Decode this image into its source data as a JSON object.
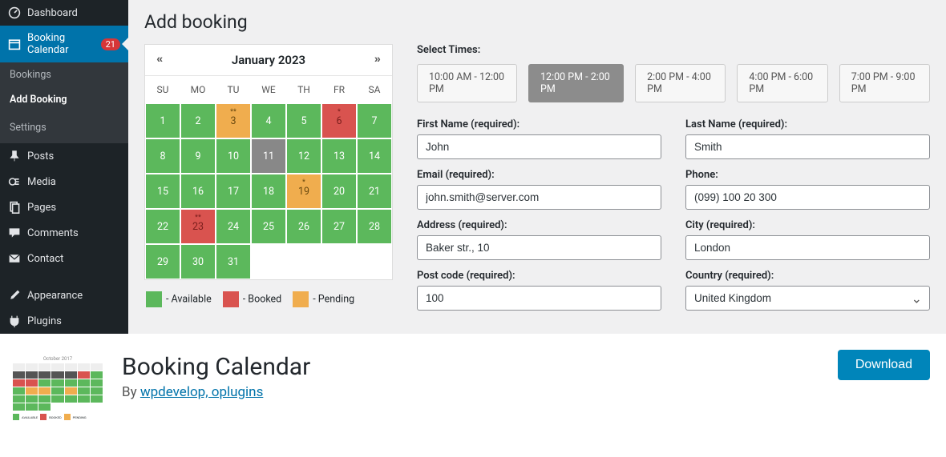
{
  "sidebar": {
    "dashboard": "Dashboard",
    "booking_calendar": "Booking Calendar",
    "badge": "21",
    "bookings": "Bookings",
    "add_booking": "Add Booking",
    "settings": "Settings",
    "posts": "Posts",
    "media": "Media",
    "pages": "Pages",
    "comments": "Comments",
    "contact": "Contact",
    "appearance": "Appearance",
    "plugins": "Plugins"
  },
  "page": {
    "title": "Add booking"
  },
  "calendar": {
    "month_label": "January 2023",
    "day_headers": [
      "SU",
      "MO",
      "TU",
      "WE",
      "TH",
      "FR",
      "SA"
    ],
    "cells": [
      {
        "day": "1",
        "status": "available"
      },
      {
        "day": "2",
        "status": "available"
      },
      {
        "day": "3",
        "status": "pending",
        "mark": "**"
      },
      {
        "day": "4",
        "status": "available"
      },
      {
        "day": "5",
        "status": "available"
      },
      {
        "day": "6",
        "status": "booked",
        "mark": "*"
      },
      {
        "day": "7",
        "status": "available"
      },
      {
        "day": "8",
        "status": "available"
      },
      {
        "day": "9",
        "status": "available"
      },
      {
        "day": "10",
        "status": "available"
      },
      {
        "day": "11",
        "status": "gray"
      },
      {
        "day": "12",
        "status": "available"
      },
      {
        "day": "13",
        "status": "available"
      },
      {
        "day": "14",
        "status": "available"
      },
      {
        "day": "15",
        "status": "available"
      },
      {
        "day": "16",
        "status": "available"
      },
      {
        "day": "17",
        "status": "available"
      },
      {
        "day": "18",
        "status": "available"
      },
      {
        "day": "19",
        "status": "pending",
        "mark": "*"
      },
      {
        "day": "20",
        "status": "available"
      },
      {
        "day": "21",
        "status": "available"
      },
      {
        "day": "22",
        "status": "available"
      },
      {
        "day": "23",
        "status": "booked",
        "mark": "**"
      },
      {
        "day": "24",
        "status": "available"
      },
      {
        "day": "25",
        "status": "available"
      },
      {
        "day": "26",
        "status": "available"
      },
      {
        "day": "27",
        "status": "available"
      },
      {
        "day": "28",
        "status": "available"
      },
      {
        "day": "29",
        "status": "available"
      },
      {
        "day": "30",
        "status": "available"
      },
      {
        "day": "31",
        "status": "available"
      }
    ],
    "legend": {
      "available": "- Available",
      "booked": "- Booked",
      "pending": "- Pending",
      "colors": {
        "available": "#5cb85c",
        "booked": "#d9534f",
        "pending": "#f0ad4e"
      }
    }
  },
  "times": {
    "label": "Select Times:",
    "slots": [
      {
        "label": "10:00 AM - 12:00 PM",
        "active": false
      },
      {
        "label": "12:00 PM - 2:00 PM",
        "active": true
      },
      {
        "label": "2:00 PM - 4:00 PM",
        "active": false
      },
      {
        "label": "4:00 PM - 6:00 PM",
        "active": false
      },
      {
        "label": "7:00 PM - 9:00 PM",
        "active": false
      }
    ]
  },
  "form": {
    "first_name_label": "First Name (required):",
    "first_name": "John",
    "last_name_label": "Last Name (required):",
    "last_name": "Smith",
    "email_label": "Email (required):",
    "email": "john.smith@server.com",
    "phone_label": "Phone:",
    "phone": "(099) 100 20 300",
    "address_label": "Address (required):",
    "address": "Baker str., 10",
    "city_label": "City (required):",
    "city": "London",
    "postcode_label": "Post code (required):",
    "postcode": "100",
    "country_label": "Country (required):",
    "country": "United Kingdom"
  },
  "footer": {
    "thumb_month": "October 2017",
    "title": "Booking Calendar",
    "by": "By ",
    "authors": "wpdevelop, oplugins",
    "download": "Download",
    "legend_available": "AVAILABLE",
    "legend_booked": "BOOKED",
    "legend_pending": "PENDING"
  }
}
